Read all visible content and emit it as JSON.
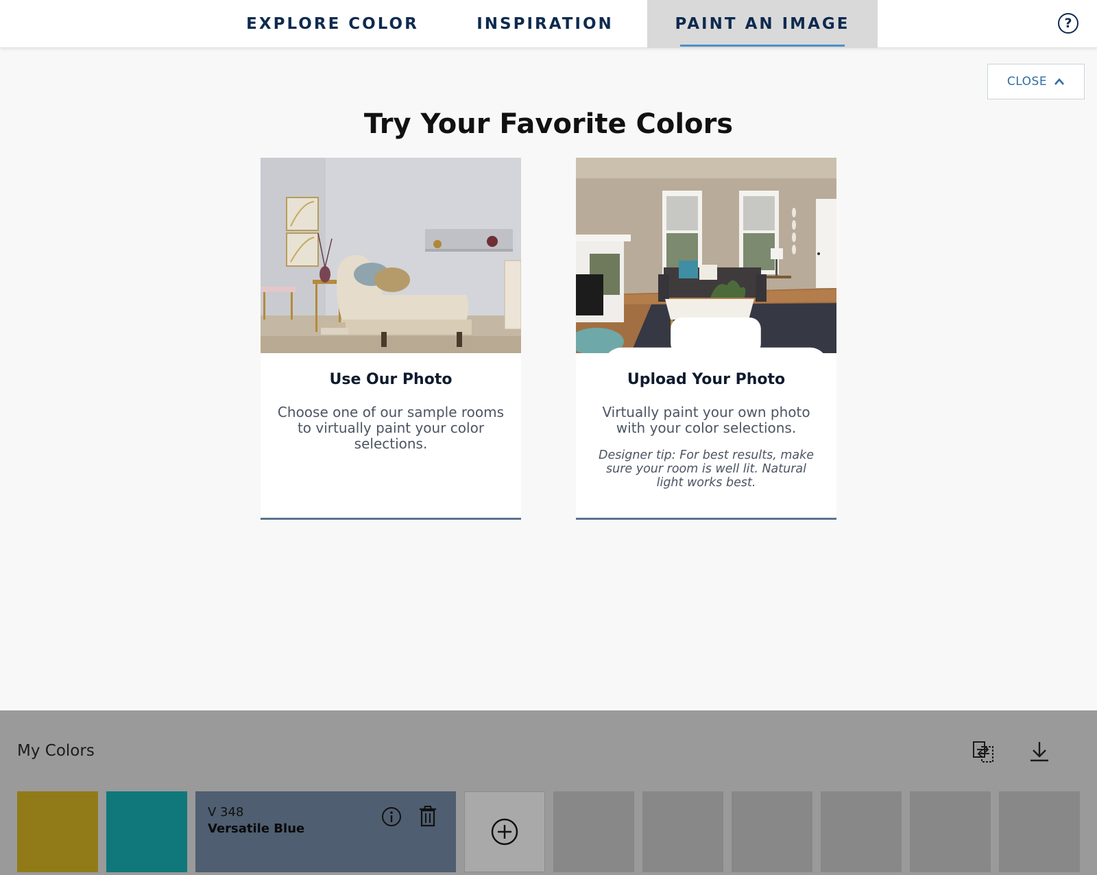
{
  "nav": {
    "tabs": [
      {
        "label": "EXPLORE COLOR",
        "active": false
      },
      {
        "label": "INSPIRATION",
        "active": false
      },
      {
        "label": "PAINT AN IMAGE",
        "active": true
      }
    ],
    "help_icon": "question-circle-icon"
  },
  "close_button": {
    "label": "CLOSE",
    "icon": "chevron-up-icon"
  },
  "heading": "Try Your Favorite Colors",
  "cards": [
    {
      "title": "Use Our Photo",
      "description": "Choose one of our sample rooms to virtually paint your color selections."
    },
    {
      "title": "Upload Your Photo",
      "description": "Virtually paint your own photo with your color selections.",
      "tip": "Designer tip: For best results, make sure your room is well lit. Natural light works best.",
      "icon": "camera-icon"
    }
  ],
  "tray": {
    "title": "My Colors",
    "icons": [
      "compare-icon",
      "download-icon"
    ],
    "swatches": [
      {
        "color": "#917b18"
      },
      {
        "color": "#10787a"
      },
      {
        "color": "#4f5e70",
        "code": "V 348",
        "name": "Versatile Blue",
        "active": true
      }
    ],
    "add_icon": "plus-circle-icon",
    "empty_slots": 6
  },
  "colors": {
    "nav_text": "#0e2a4f",
    "accent": "#4a90c8",
    "tray_bg": "#9a9a9a"
  }
}
